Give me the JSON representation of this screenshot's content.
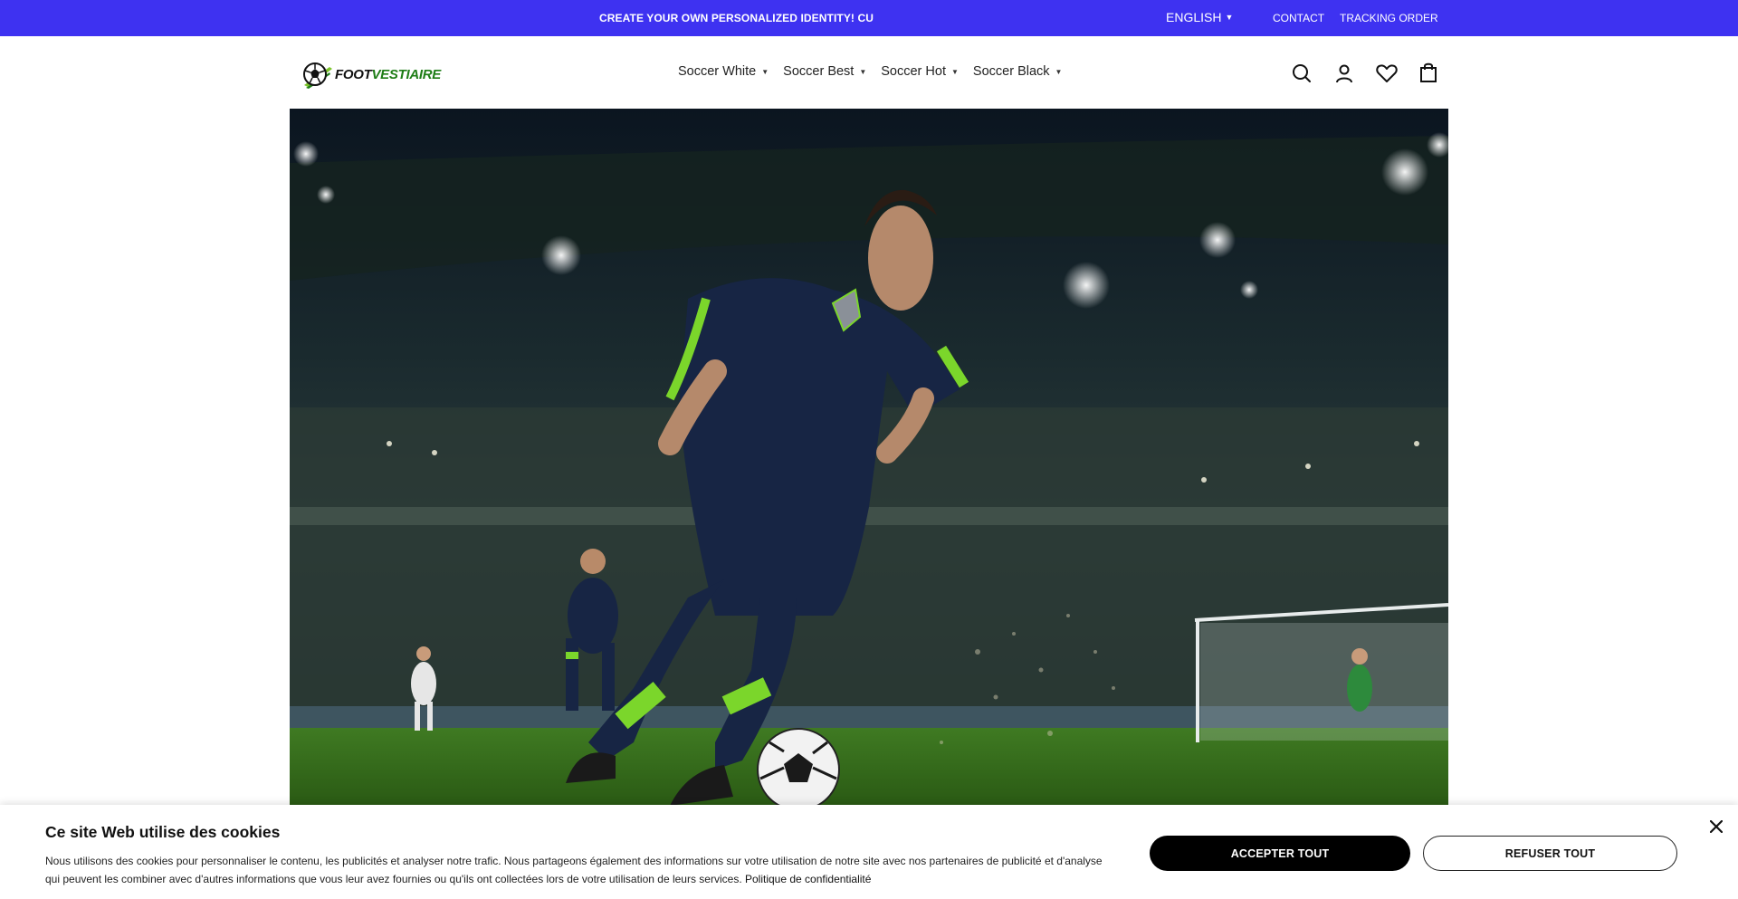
{
  "announcement": {
    "promo_text": "CREATE YOUR OWN PERSONALIZED IDENTITY! CU",
    "language": "ENGLISH",
    "links": [
      "CONTACT",
      "TRACKING ORDER"
    ],
    "background_color": "#3e32f1"
  },
  "header": {
    "logo": {
      "part1": "FOOT",
      "part2": "VESTIAIRE",
      "icon": "soccer-ball-icon"
    },
    "nav": [
      {
        "label": "Soccer White"
      },
      {
        "label": "Soccer Best"
      },
      {
        "label": "Soccer Hot"
      },
      {
        "label": "Soccer Black"
      }
    ],
    "icons": [
      "search-icon",
      "account-icon",
      "wishlist-heart-icon",
      "cart-bag-icon"
    ]
  },
  "hero": {
    "image": "soccer player in navy and lime kit dribbling ball in floodlit stadium"
  },
  "cookie_banner": {
    "title": "Ce site Web utilise des cookies",
    "description": "Nous utilisons des cookies pour personnaliser le contenu, les publicités et analyser notre trafic. Nous partageons également des informations sur votre utilisation de notre site avec nos partenaires de publicité et d'analyse qui peuvent les combiner avec d'autres informations que vous leur avez fournies ou qu'ils ont collectées lors de votre utilisation de leurs services.",
    "policy_link": "Politique de confidentialité",
    "accept_label": "ACCEPTER TOUT",
    "refuse_label": "REFUSER TOUT",
    "close_icon": "close-icon"
  }
}
